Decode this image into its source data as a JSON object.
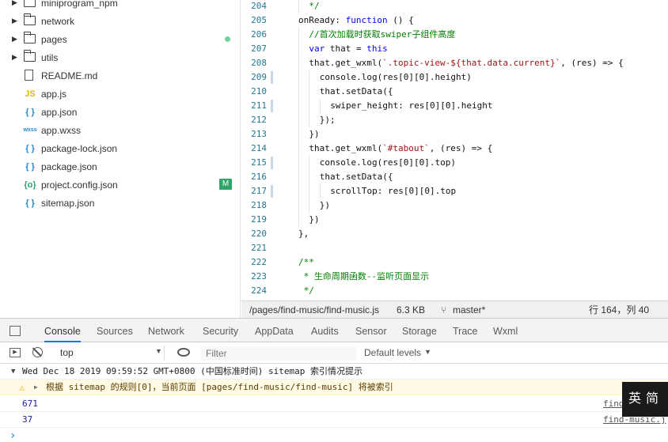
{
  "file_tree": [
    {
      "type": "folder",
      "name": "miniprogram_npm"
    },
    {
      "type": "folder",
      "name": "network"
    },
    {
      "type": "folder",
      "name": "pages",
      "dot": true
    },
    {
      "type": "folder",
      "name": "utils"
    },
    {
      "type": "file",
      "icon": "doc",
      "name": "README.md"
    },
    {
      "type": "file",
      "icon": "JS",
      "name": "app.js"
    },
    {
      "type": "file",
      "icon": "{ }",
      "name": "app.json"
    },
    {
      "type": "file",
      "icon": "wxss",
      "name": "app.wxss"
    },
    {
      "type": "file",
      "icon": "{ }",
      "name": "package-lock.json"
    },
    {
      "type": "file",
      "icon": "{ }",
      "name": "package.json"
    },
    {
      "type": "file",
      "icon": "{o}",
      "name": "project.config.json",
      "badge": "M"
    },
    {
      "type": "file",
      "icon": "{ }",
      "name": "sitemap.json"
    }
  ],
  "code_lines": [
    {
      "n": "204",
      "mark": false,
      "indent": 1,
      "parts": [
        {
          "t": "*/",
          "c": "cmt"
        }
      ]
    },
    {
      "n": "205",
      "mark": false,
      "indent": 0,
      "parts": [
        {
          "t": "onReady: ",
          "c": "prop"
        },
        {
          "t": "function",
          "c": "kw"
        },
        {
          "t": " () {",
          "c": "prop"
        }
      ]
    },
    {
      "n": "206",
      "mark": false,
      "indent": 1,
      "parts": [
        {
          "t": "//首次加载时获取swiper子组件高度",
          "c": "cmt"
        }
      ]
    },
    {
      "n": "207",
      "mark": false,
      "indent": 1,
      "parts": [
        {
          "t": "var",
          "c": "kw"
        },
        {
          "t": " that = ",
          "c": "prop"
        },
        {
          "t": "this",
          "c": "kw"
        }
      ]
    },
    {
      "n": "208",
      "mark": false,
      "indent": 1,
      "parts": [
        {
          "t": "that.get_wxml(",
          "c": "prop"
        },
        {
          "t": "`.topic-view-${that.data.current}`",
          "c": "str"
        },
        {
          "t": ", (res) => {",
          "c": "prop"
        }
      ]
    },
    {
      "n": "209",
      "mark": true,
      "indent": 2,
      "parts": [
        {
          "t": "console.log(res[0][0].height)",
          "c": "prop"
        }
      ]
    },
    {
      "n": "210",
      "mark": false,
      "indent": 2,
      "parts": [
        {
          "t": "that.setData({",
          "c": "prop"
        }
      ]
    },
    {
      "n": "211",
      "mark": true,
      "indent": 3,
      "parts": [
        {
          "t": "swiper_height: res[0][0].height",
          "c": "prop"
        }
      ]
    },
    {
      "n": "212",
      "mark": false,
      "indent": 2,
      "parts": [
        {
          "t": "});",
          "c": "prop"
        }
      ]
    },
    {
      "n": "213",
      "mark": false,
      "indent": 1,
      "parts": [
        {
          "t": "})",
          "c": "prop"
        }
      ]
    },
    {
      "n": "214",
      "mark": false,
      "indent": 1,
      "parts": [
        {
          "t": "that.get_wxml(",
          "c": "prop"
        },
        {
          "t": "`#tabout`",
          "c": "str"
        },
        {
          "t": ", (res) => {",
          "c": "prop"
        }
      ]
    },
    {
      "n": "215",
      "mark": true,
      "indent": 2,
      "parts": [
        {
          "t": "console.log(res[0][0].top)",
          "c": "prop"
        }
      ]
    },
    {
      "n": "216",
      "mark": false,
      "indent": 2,
      "parts": [
        {
          "t": "that.setData({",
          "c": "prop"
        }
      ]
    },
    {
      "n": "217",
      "mark": true,
      "indent": 3,
      "parts": [
        {
          "t": "scrollTop: res[0][0].top",
          "c": "prop"
        }
      ]
    },
    {
      "n": "218",
      "mark": false,
      "indent": 2,
      "parts": [
        {
          "t": "})",
          "c": "prop"
        }
      ]
    },
    {
      "n": "219",
      "mark": false,
      "indent": 1,
      "parts": [
        {
          "t": "})",
          "c": "prop"
        }
      ]
    },
    {
      "n": "220",
      "mark": false,
      "indent": 0,
      "parts": [
        {
          "t": "},",
          "c": "prop"
        }
      ]
    },
    {
      "n": "221",
      "mark": false,
      "indent": 0,
      "parts": []
    },
    {
      "n": "222",
      "mark": false,
      "indent": 0,
      "parts": [
        {
          "t": "/**",
          "c": "cmt"
        }
      ]
    },
    {
      "n": "223",
      "mark": false,
      "indent": 0,
      "parts": [
        {
          "t": " * 生命周期函数--监听页面显示",
          "c": "cmt"
        }
      ]
    },
    {
      "n": "224",
      "mark": false,
      "indent": 0,
      "parts": [
        {
          "t": " */",
          "c": "cmt"
        }
      ]
    }
  ],
  "status": {
    "path": "/pages/find-music/find-music.js",
    "size": "6.3 KB",
    "branch": "master*",
    "position": "行 164，列 40"
  },
  "devtools": {
    "tabs": [
      "Console",
      "Sources",
      "Network",
      "Security",
      "AppData",
      "Audits",
      "Sensor",
      "Storage",
      "Trace",
      "Wxml"
    ],
    "active_tab": "Console",
    "context": "top",
    "filter_placeholder": "Filter",
    "levels": "Default levels"
  },
  "console": {
    "group": "Wed Dec 18 2019 09:59:52 GMT+0800 (中国标准时间) sitemap 索引情况提示",
    "warning": "根据 sitemap 的规则[0]，当前页面 [pages/find-music/find-music] 将被索引",
    "logs": [
      {
        "value": "671",
        "source": "find"
      },
      {
        "value": "37",
        "source": "find-music.j"
      }
    ],
    "prompt": "›"
  },
  "ime": "英简"
}
